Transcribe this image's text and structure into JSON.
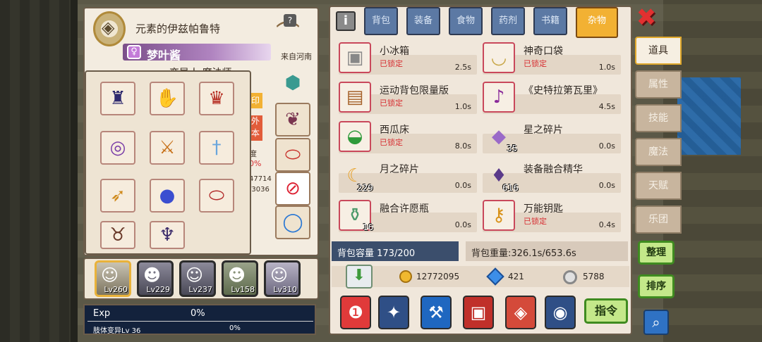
{
  "character": {
    "title": "元素的伊兹帕鲁特",
    "name": "梦叶酱",
    "origin": "来自河南",
    "race_class": "变异人 魔法师",
    "partial_texts": [
      "印",
      "外",
      "本",
      "度",
      "0%",
      "47714",
      "/3036"
    ]
  },
  "equipment": {
    "slots": [
      "dark-helmet",
      "white-glove",
      "red-mask",
      "gold-ring",
      "flame-blade",
      "ice-sword",
      "fire-dagger",
      "blue-orb",
      "red-bracelet",
      "bunny-ears",
      "winged-crest"
    ],
    "side_slots": [
      "shield-crest",
      "purple-beast",
      "red-bracelet",
      "no-entry-sign",
      "blue-ring"
    ]
  },
  "party": [
    {
      "level": "Lv260",
      "selected": true
    },
    {
      "level": "Lv229",
      "selected": false
    },
    {
      "level": "Lv237",
      "selected": false
    },
    {
      "level": "Lv158",
      "selected": false
    },
    {
      "level": "Lv310",
      "selected": false
    }
  ],
  "exp": {
    "label": "Exp",
    "value": "0%",
    "skill_label": "肢体变异Lv 36",
    "skill_value": "0%"
  },
  "inventory": {
    "tabs": [
      "背包",
      "装备",
      "食物",
      "药剂",
      "书籍",
      "杂物"
    ],
    "active_tab": "杂物",
    "info_label": "i",
    "items": [
      {
        "name": "小冰箱",
        "locked": "已锁定",
        "time": "2.5s",
        "count": "",
        "icon": "fridge-icon"
      },
      {
        "name": "神奇口袋",
        "locked": "已锁定",
        "time": "1.0s",
        "count": "",
        "icon": "pouch-icon"
      },
      {
        "name": "运动背包限量版",
        "locked": "已锁定",
        "time": "1.0s",
        "count": "",
        "icon": "backpack-icon"
      },
      {
        "name": "《史特拉第瓦里》",
        "locked": "",
        "time": "4.5s",
        "count": "",
        "icon": "violin-icon"
      },
      {
        "name": "西瓜床",
        "locked": "已锁定",
        "time": "8.0s",
        "count": "",
        "icon": "watermelon-bed-icon"
      },
      {
        "name": "星之碎片",
        "locked": "",
        "time": "0.0s",
        "count": "35",
        "icon": "star-shard-icon"
      },
      {
        "name": "月之碎片",
        "locked": "",
        "time": "0.0s",
        "count": "229",
        "icon": "moon-shard-icon"
      },
      {
        "name": "装备融合精华",
        "locked": "",
        "time": "0.0s",
        "count": "616",
        "icon": "fusion-essence-icon"
      },
      {
        "name": "融合许愿瓶",
        "locked": "",
        "time": "0.0s",
        "count": "16",
        "icon": "wish-bottle-icon"
      },
      {
        "name": "万能钥匙",
        "locked": "已锁定",
        "time": "0.4s",
        "count": "",
        "icon": "master-key-icon"
      }
    ],
    "capacity": "背包容量 173/200",
    "weight": "背包重量:326.1s/653.6s"
  },
  "currency": {
    "gold": "12772095",
    "gems": "421",
    "silver": "5788"
  },
  "bottom_buttons": [
    "scroll-icon",
    "gear-badge-icon",
    "axe-badge-icon",
    "green-book-icon",
    "red-cube-icon",
    "ring-badge-icon"
  ],
  "command_label": "指令",
  "side_tabs": [
    "道具",
    "属性",
    "技能",
    "魔法",
    "天赋",
    "乐团"
  ],
  "active_side_tab": "道具",
  "actions": {
    "organize": "整理",
    "sort": "排序"
  },
  "close_label": "✖",
  "colors": {
    "locked": "#d72f33",
    "tab_active": "#f2b133",
    "tab_inactive": "#5c79a4",
    "confirm_green": "#c4e88a"
  }
}
